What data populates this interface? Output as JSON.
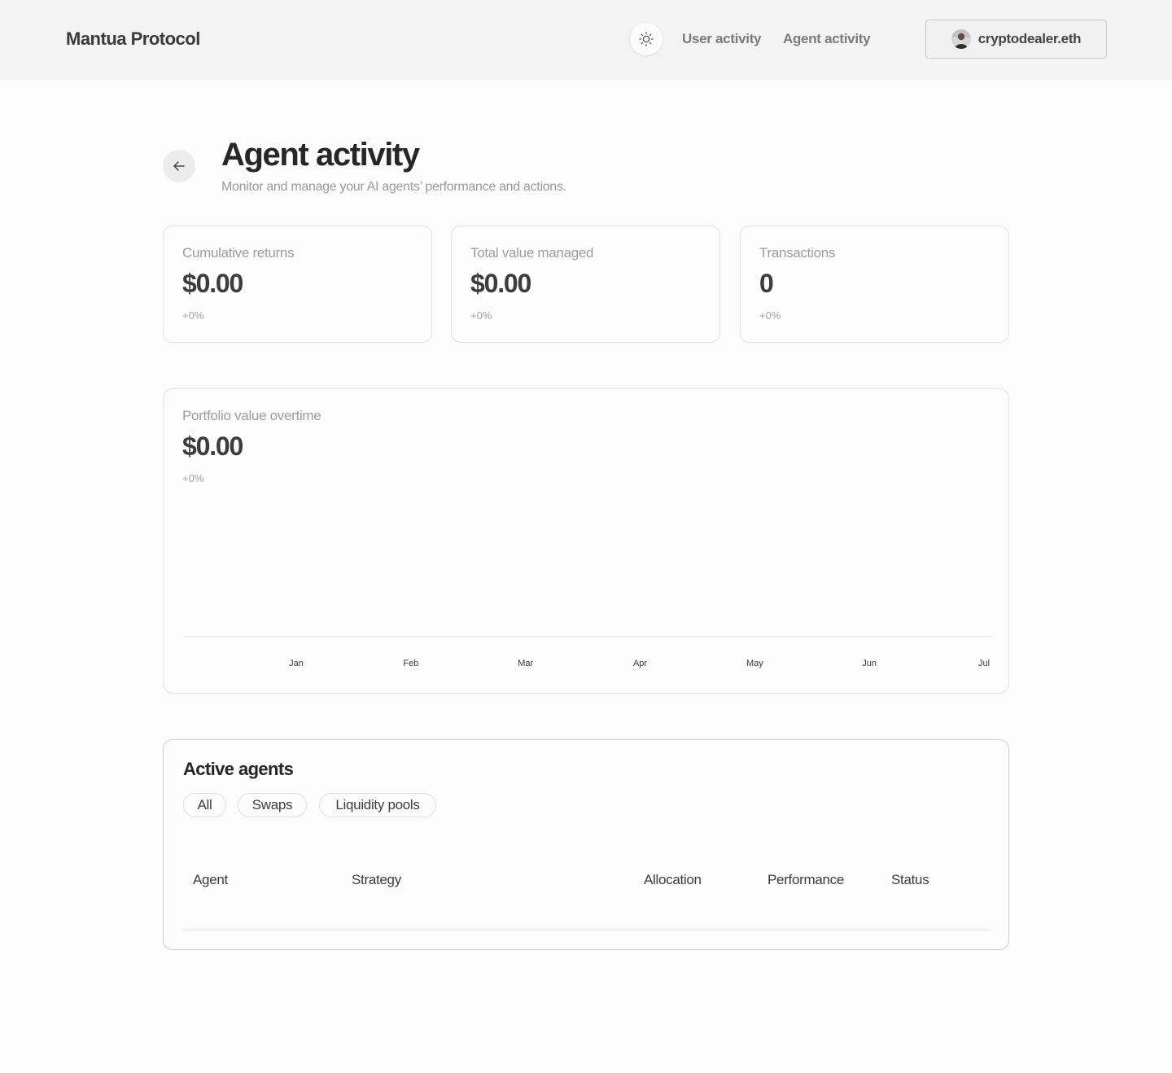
{
  "header": {
    "brand": "Mantua Protocol",
    "nav": {
      "user_activity": "User activity",
      "agent_activity": "Agent activity"
    },
    "wallet": {
      "name": "cryptodealer.eth"
    },
    "icons": {
      "theme": "sun-icon",
      "avatar": "avatar"
    }
  },
  "page": {
    "title": "Agent activity",
    "subtitle": "Monitor and manage your AI agents’ performance and actions.",
    "back_icon": "arrow-left-icon"
  },
  "stats": [
    {
      "label": "Cumulative returns",
      "value": "$0.00",
      "change": "+0%"
    },
    {
      "label": "Total value managed",
      "value": "$0.00",
      "change": "+0%"
    },
    {
      "label": "Transactions",
      "value": "0",
      "change": "+0%"
    }
  ],
  "portfolio": {
    "label": "Portfolio value overtime",
    "value": "$0.00",
    "change": "+0%"
  },
  "chart_data": {
    "type": "line",
    "categories": [
      "Jan",
      "Feb",
      "Mar",
      "Apr",
      "May",
      "Jun",
      "Jul"
    ],
    "series": [],
    "title": "Portfolio value overtime",
    "xlabel": "",
    "ylabel": "",
    "grid": false
  },
  "agents": {
    "title": "Active agents",
    "filters": [
      "All",
      "Swaps",
      "Liquidity pools"
    ],
    "columns": [
      "Agent",
      "Strategy",
      "Allocation",
      "Performance",
      "Status"
    ],
    "rows": []
  },
  "colors": {
    "background": "#fcfcfc",
    "header_bg": "#f3f3f3",
    "text_primary": "#262626",
    "text_muted": "#9d9d9d",
    "border": "#e2e2e2"
  }
}
